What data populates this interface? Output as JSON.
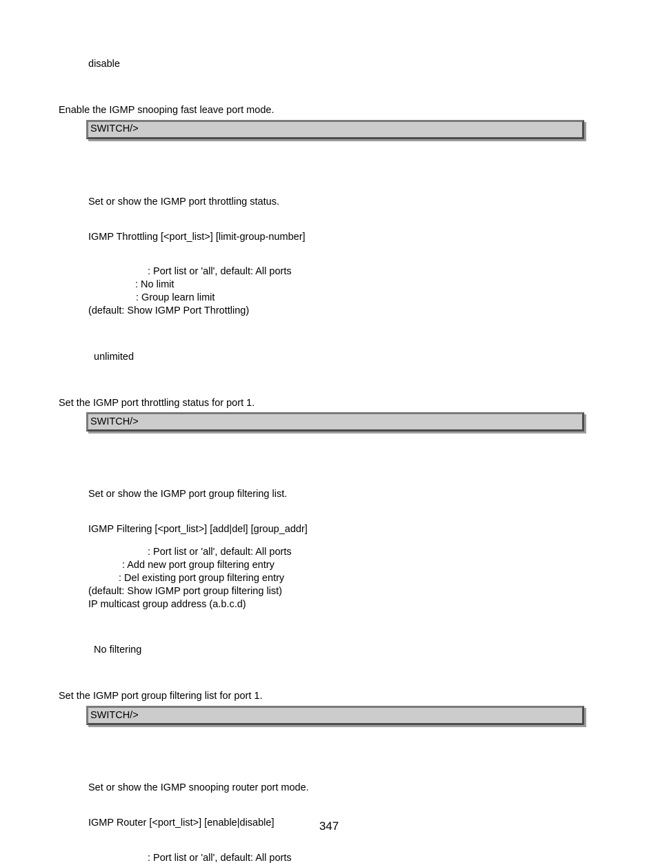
{
  "pageNumber": "347",
  "section1": {
    "default_setting": "disable",
    "example_line": "Enable the IGMP snooping fast leave port mode.",
    "code": "SWITCH/>"
  },
  "section2": {
    "desc": "Set or show the IGMP port throttling status.",
    "syntax": "IGMP Throttling [<port_list>] [limit-group-number]",
    "param1": ": Port list or 'all', default: All ports",
    "param2": ": No limit",
    "param3": ": Group learn limit",
    "param4": "(default: Show IGMP Port Throttling)",
    "default_setting": "unlimited",
    "example_line": "Set the IGMP port throttling status for port 1.",
    "code": "SWITCH/>"
  },
  "section3": {
    "desc": "Set or show the IGMP port group filtering list.",
    "syntax": "IGMP Filtering [<port_list>] [add|del] [group_addr]",
    "param1": ": Port list or 'all', default: All ports",
    "param2": ": Add new port group filtering entry",
    "param3": ": Del existing port group filtering entry",
    "param4": "(default: Show IGMP port group filtering list)",
    "param5": "IP multicast group address (a.b.c.d)",
    "default_setting": "No filtering",
    "example_line": "Set the IGMP port group filtering list for port 1.",
    "code": "SWITCH/>"
  },
  "section4": {
    "desc": "Set or show the IGMP snooping router port mode.",
    "syntax": "IGMP Router [<port_list>] [enable|disable]",
    "param1": ": Port list or 'all', default: All ports"
  }
}
